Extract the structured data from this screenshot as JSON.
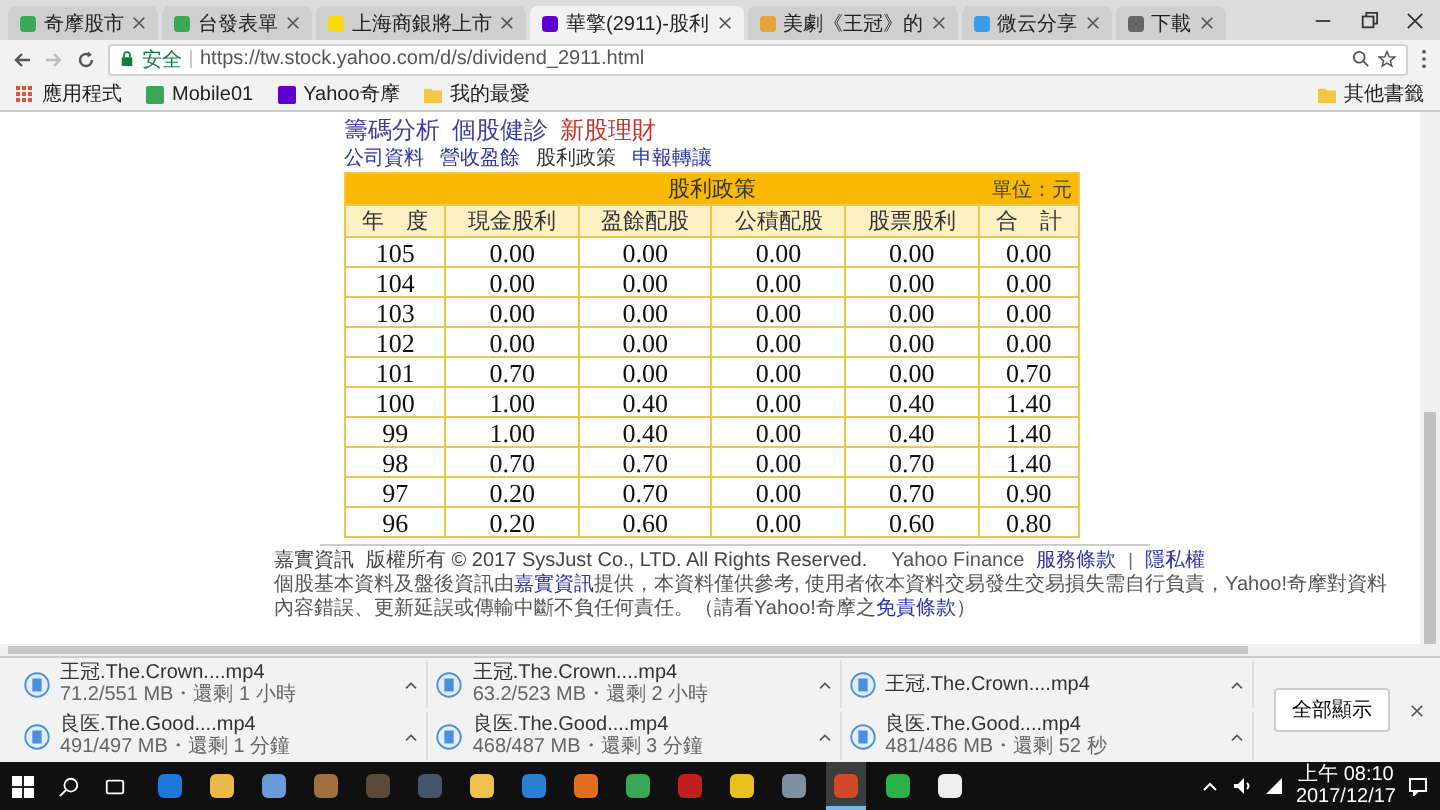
{
  "browser": {
    "tabs": [
      {
        "title": "奇摩股市",
        "selected": false,
        "color": "#3aa757"
      },
      {
        "title": "台發表單",
        "selected": false,
        "color": "#3aa757"
      },
      {
        "title": "上海商銀將上市",
        "selected": false,
        "color": "#f5d90a"
      },
      {
        "title": "華擎(2911)-股利",
        "selected": true,
        "color": "#5f01d1"
      },
      {
        "title": "美劇《王冠》的",
        "selected": false,
        "color": "#e8a33d"
      },
      {
        "title": "微云分享",
        "selected": false,
        "color": "#3b9be8"
      },
      {
        "title": "下載",
        "selected": false,
        "color": "#666666"
      }
    ],
    "address": {
      "security": "安全",
      "url": "https://tw.stock.yahoo.com/d/s/dividend_2911.html"
    },
    "bookmarks": [
      {
        "label": "應用程式",
        "kind": "apps"
      },
      {
        "label": "Mobile01",
        "kind": "site"
      },
      {
        "label": "Yahoo奇摩",
        "kind": "yahoo"
      },
      {
        "label": "我的最愛",
        "kind": "folder"
      }
    ],
    "other_bookmarks": "其他書籤"
  },
  "page": {
    "heading_links": [
      {
        "label": "籌碼分析",
        "featured": false
      },
      {
        "label": "個股健診",
        "featured": false
      },
      {
        "label": "新股理財",
        "featured": true
      }
    ],
    "nav": [
      {
        "label": "公司資料",
        "selected": false
      },
      {
        "label": "營收盈餘",
        "selected": false
      },
      {
        "label": "股利政策",
        "selected": true
      },
      {
        "label": "申報轉讓",
        "selected": false
      }
    ],
    "table": {
      "title": "股利政策",
      "unit": "單位：元",
      "columns": [
        "年　度",
        "現金股利",
        "盈餘配股",
        "公積配股",
        "股票股利",
        "合　計"
      ],
      "rows": [
        [
          "105",
          "0.00",
          "0.00",
          "0.00",
          "0.00",
          "0.00"
        ],
        [
          "104",
          "0.00",
          "0.00",
          "0.00",
          "0.00",
          "0.00"
        ],
        [
          "103",
          "0.00",
          "0.00",
          "0.00",
          "0.00",
          "0.00"
        ],
        [
          "102",
          "0.00",
          "0.00",
          "0.00",
          "0.00",
          "0.00"
        ],
        [
          "101",
          "0.70",
          "0.00",
          "0.00",
          "0.00",
          "0.70"
        ],
        [
          "100",
          "1.00",
          "0.40",
          "0.00",
          "0.40",
          "1.40"
        ],
        [
          "99",
          "1.00",
          "0.40",
          "0.00",
          "0.40",
          "1.40"
        ],
        [
          "98",
          "0.70",
          "0.70",
          "0.00",
          "0.70",
          "1.40"
        ],
        [
          "97",
          "0.20",
          "0.70",
          "0.00",
          "0.70",
          "0.90"
        ],
        [
          "96",
          "0.20",
          "0.60",
          "0.00",
          "0.60",
          "0.80"
        ]
      ]
    },
    "footer": {
      "brand": "Yahoo Finance",
      "links": [
        "服務條款",
        "隱私權"
      ],
      "separator": "|",
      "source": "嘉實資訊",
      "copyright": "版權所有 © 2017 SysJust Co., LTD. All Rights Reserved.",
      "disclaimer": [
        {
          "text": "個股基本資料及盤後資訊由",
          "link": false
        },
        {
          "text": "嘉實資訊",
          "link": true
        },
        {
          "text": "提供，本資料僅供參考, 使用者依本資料交易發生交易損失需自行負責，Yahoo!奇摩對資料內容錯誤、更新延誤或傳輸中斷不負任何責任。（請看Yahoo!奇摩之",
          "link": false
        },
        {
          "text": "免責條款",
          "link": true
        },
        {
          "text": "）",
          "link": false
        }
      ]
    }
  },
  "downloads": {
    "items": [
      {
        "name": "王冠.The.Crown....mp4",
        "detail": "71.2/551 MB・還剩 1 小時"
      },
      {
        "name": "王冠.The.Crown....mp4",
        "detail": "63.2/523 MB・還剩 2 小時"
      },
      {
        "name": "王冠.The.Crown....mp4"
      },
      {
        "name": "良医.The.Good....mp4",
        "detail": "491/497 MB・還剩 1 分鐘"
      },
      {
        "name": "良医.The.Good....mp4",
        "detail": "468/487 MB・還剩 3 分鐘"
      },
      {
        "name": "良医.The.Good....mp4",
        "detail": "481/486 MB・還剩 52 秒"
      }
    ],
    "show_all": "全部顯示"
  },
  "taskbar": {
    "apps": [
      {
        "color": "#1e78d7",
        "active": false
      },
      {
        "color": "#e9b949",
        "active": false
      },
      {
        "color": "#6a9bd8",
        "active": false
      },
      {
        "color": "#a07040",
        "active": false
      },
      {
        "color": "#5a4a3a",
        "active": false
      },
      {
        "color": "#44556a",
        "active": false
      },
      {
        "color": "#f0c050",
        "active": false
      },
      {
        "color": "#2a7fd0",
        "active": false
      },
      {
        "color": "#e07020",
        "active": false
      },
      {
        "color": "#3aa757",
        "active": false
      },
      {
        "color": "#c02020",
        "active": false
      },
      {
        "color": "#e8c020",
        "active": false
      },
      {
        "color": "#8090a0",
        "active": false
      },
      {
        "color": "#d04a2a",
        "active": true
      },
      {
        "color": "#2cb24a",
        "active": false
      },
      {
        "color": "#eeeeee",
        "active": false
      }
    ],
    "time": "上午 08:10",
    "date": "2017/12/17"
  }
}
